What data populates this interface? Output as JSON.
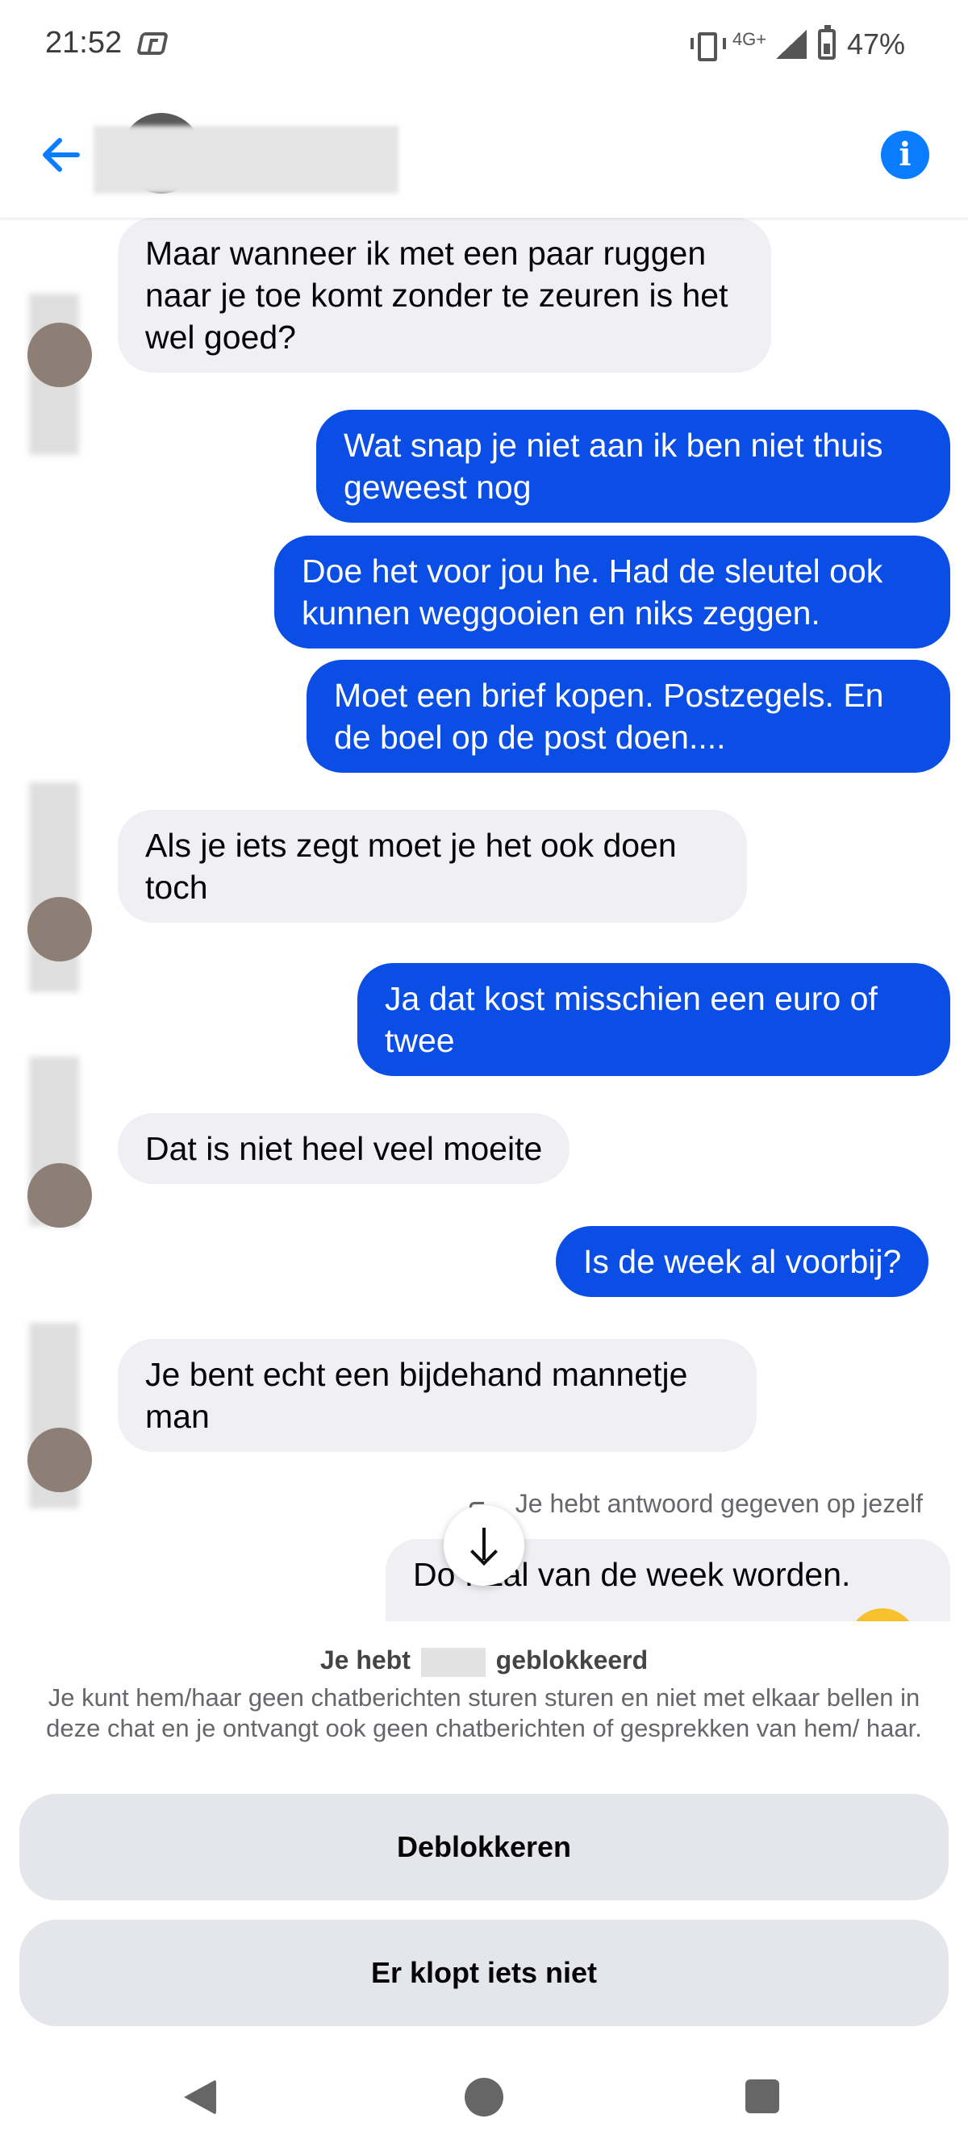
{
  "status_bar": {
    "time": "21:52",
    "network": "4G+",
    "battery": "47%",
    "icons": [
      "notification-icon",
      "vibrate-icon",
      "network-icon",
      "signal-icon",
      "battery-icon"
    ]
  },
  "header": {
    "back_icon": "arrow-left",
    "info_icon": "info-circle",
    "info_glyph": "i",
    "accent_color": "#0a7cff"
  },
  "messages": [
    {
      "side": "in",
      "text": "Maar wanneer ik met een paar ruggen naar je toe komt zonder te zeuren is het wel goed?"
    },
    {
      "side": "out",
      "text": "Wat snap je niet aan ik ben niet thuis geweest nog"
    },
    {
      "side": "out",
      "text": "Doe het voor jou he. Had de sleutel ook kunnen weggooien en niks zeggen."
    },
    {
      "side": "out",
      "text": "Moet een brief kopen. Postzegels. En de boel op de post doen...."
    },
    {
      "side": "in",
      "text": "Als je iets zegt moet je het ook doen toch"
    },
    {
      "side": "out",
      "text": "Ja dat kost misschien een euro of twee"
    },
    {
      "side": "in",
      "text": "Dat is niet heel veel moeite"
    },
    {
      "side": "out",
      "text": "Is de week al voorbij?"
    },
    {
      "side": "in",
      "text": "Je bent echt een bijdehand mannetje man"
    }
  ],
  "reply_note": "Je hebt antwoord gegeven op jezelf",
  "reply_preview_text": "Do   . Zal van de week worden.",
  "colors": {
    "outgoing_bubble": "#0a4ee5",
    "incoming_bubble": "#f0f0f4"
  },
  "blocked": {
    "title_prefix": "Je hebt",
    "title_suffix": "geblokkeerd",
    "description": "Je kunt hem/haar geen chatberichten sturen sturen en niet met elkaar bellen in deze chat en je ontvangt ook geen chatberichten of gesprekken van hem/ haar.",
    "unblock_label": "Deblokkeren",
    "report_label": "Er klopt iets niet"
  },
  "nav": {
    "icons": [
      "back-triangle",
      "home-circle",
      "recents-square"
    ]
  }
}
